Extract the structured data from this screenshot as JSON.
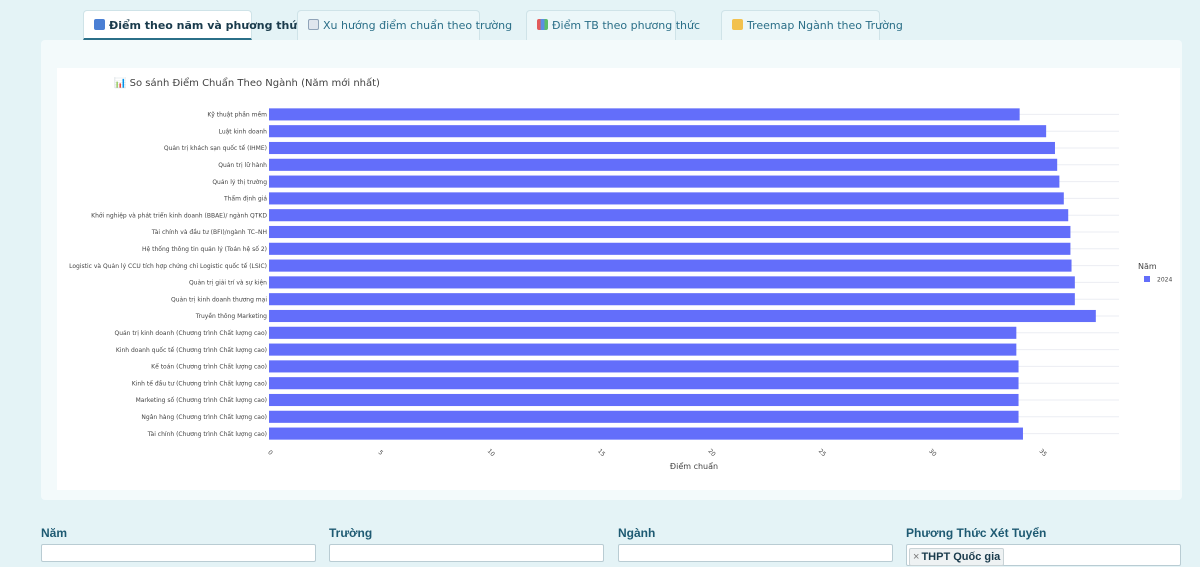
{
  "tabs": [
    {
      "label": "Điểm theo năm và phương thức",
      "icon": "grid-icon",
      "active": true
    },
    {
      "label": "Xu hướng điểm chuẩn theo trường",
      "icon": "trend-chart-icon"
    },
    {
      "label": "Điểm TB theo phương thức",
      "icon": "bar-chart-icon"
    },
    {
      "label": "Treemap Ngành theo Trường",
      "icon": "folder-icon"
    }
  ],
  "colors": {
    "bar": "#636efa",
    "grid": "#ebedf3",
    "axis_text": "#444444"
  },
  "chart_data": {
    "type": "bar",
    "orientation": "horizontal",
    "title": "📊 So sánh Điểm Chuẩn Theo Ngành (Năm mới nhất)",
    "xlabel": "Điểm chuẩn",
    "ylabel": "",
    "xlim": [
      0,
      38.5
    ],
    "xticks": [
      0,
      5,
      10,
      15,
      20,
      25,
      30,
      35
    ],
    "legend_title": "Năm",
    "legend_position": "right",
    "series": [
      {
        "name": "2024",
        "color": "#636efa"
      }
    ],
    "categories": [
      "Kỹ thuật phần mềm",
      "Luật kinh doanh",
      "Quản trị khách sạn quốc tế (IHME)",
      "Quản trị lữ hành",
      "Quản lý thị trường",
      "Thẩm định giá",
      "Khởi nghiệp và phát triển kinh doanh (BBAE)/ ngành QTKD",
      "Tài chính và đầu tư (BFI)/ngành TC–NH",
      "Hệ thống thông tin quản lý (Toán hệ số 2)",
      "Logistic và Quản lý CCU tích hợp chứng chỉ Logistic quốc tế (LSIC)",
      "Quản trị giải trí và sự kiện",
      "Quản trị kinh doanh thương mại",
      "Truyền thông Marketing",
      "Quản trị kinh doanh (Chương trình Chất lượng cao)",
      "Kinh doanh quốc tế (Chương trình Chất lượng cao)",
      "Kế toán (Chương trình Chất lượng cao)",
      "Kinh tế đầu tư (Chương trình Chất lượng cao)",
      "Marketing số (Chương trình Chất lượng cao)",
      "Ngân hàng (Chương trình Chất lượng cao)",
      "Tài chính (Chương trình Chất lượng cao)"
    ],
    "values": [
      34.0,
      35.2,
      35.6,
      35.7,
      35.8,
      36.0,
      36.2,
      36.3,
      36.3,
      36.35,
      36.5,
      36.5,
      37.45,
      33.85,
      33.85,
      33.95,
      33.95,
      33.95,
      33.95,
      34.15
    ]
  },
  "filters": {
    "year_label": "Năm",
    "school_label": "Trường",
    "major_label": "Ngành",
    "method_label": "Phương Thức Xét Tuyển",
    "method_selected": "THPT Quốc gia",
    "chip_remove": "×"
  }
}
